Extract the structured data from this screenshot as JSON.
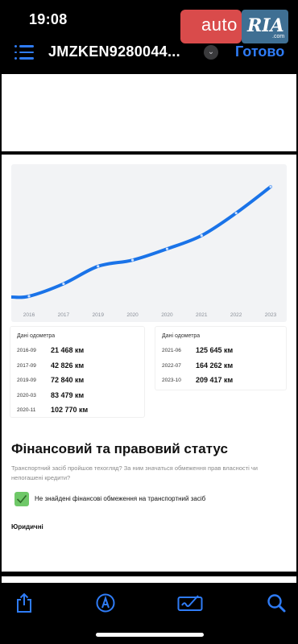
{
  "status_bar": {
    "time": "19:08"
  },
  "brand": {
    "auto": "auto",
    "ria": "RIA",
    "domain": ".com"
  },
  "nav": {
    "title": "JMZKEN9280044...",
    "done_label": "Готово"
  },
  "chart_data": {
    "type": "line",
    "x": [
      "2016-09",
      "2017-09",
      "2019-09",
      "2020-03",
      "2020-11",
      "2021-06",
      "2022-07",
      "2023-10"
    ],
    "tick_labels": [
      "2016",
      "2017",
      "2019",
      "2020",
      "2020",
      "2021",
      "2022",
      "2023"
    ],
    "values": [
      21468,
      42826,
      72840,
      83479,
      102770,
      125645,
      164262,
      209417
    ],
    "title": "",
    "xlabel": "",
    "ylabel": "",
    "color": "#1a73e8"
  },
  "odometer": {
    "left_title": "Дані одометра",
    "right_title": "Дані одометра",
    "left_rows": [
      {
        "date": "2016-09",
        "value": "21 468 км"
      },
      {
        "date": "2017-09",
        "value": "42 826 км"
      },
      {
        "date": "2019-09",
        "value": "72 840 км"
      },
      {
        "date": "2020-03",
        "value": "83 479 км"
      },
      {
        "date": "2020-11",
        "value": "102 770 км"
      }
    ],
    "right_rows": [
      {
        "date": "2021-06",
        "value": "125 645 км"
      },
      {
        "date": "2022-07",
        "value": "164 262 км"
      },
      {
        "date": "2023-10",
        "value": "209 417 км"
      }
    ]
  },
  "finance": {
    "heading": "Фінансовий та правовий статус",
    "description": "Транспортний засіб пройшов техогляд? За ним значаться обмеження прав власності чи непогашені кредити?",
    "check_label": "Не знайдені фінансові обмеження на транспортний засіб",
    "legal_heading": "Юридичні"
  },
  "toolbar": {
    "icons": [
      "share-icon",
      "markup-icon",
      "signature-icon",
      "search-icon"
    ]
  },
  "colors": {
    "accent": "#2f7cf6",
    "check": "#6fc868",
    "brand_red": "#d94b4b",
    "brand_blue": "#3f6f93"
  }
}
